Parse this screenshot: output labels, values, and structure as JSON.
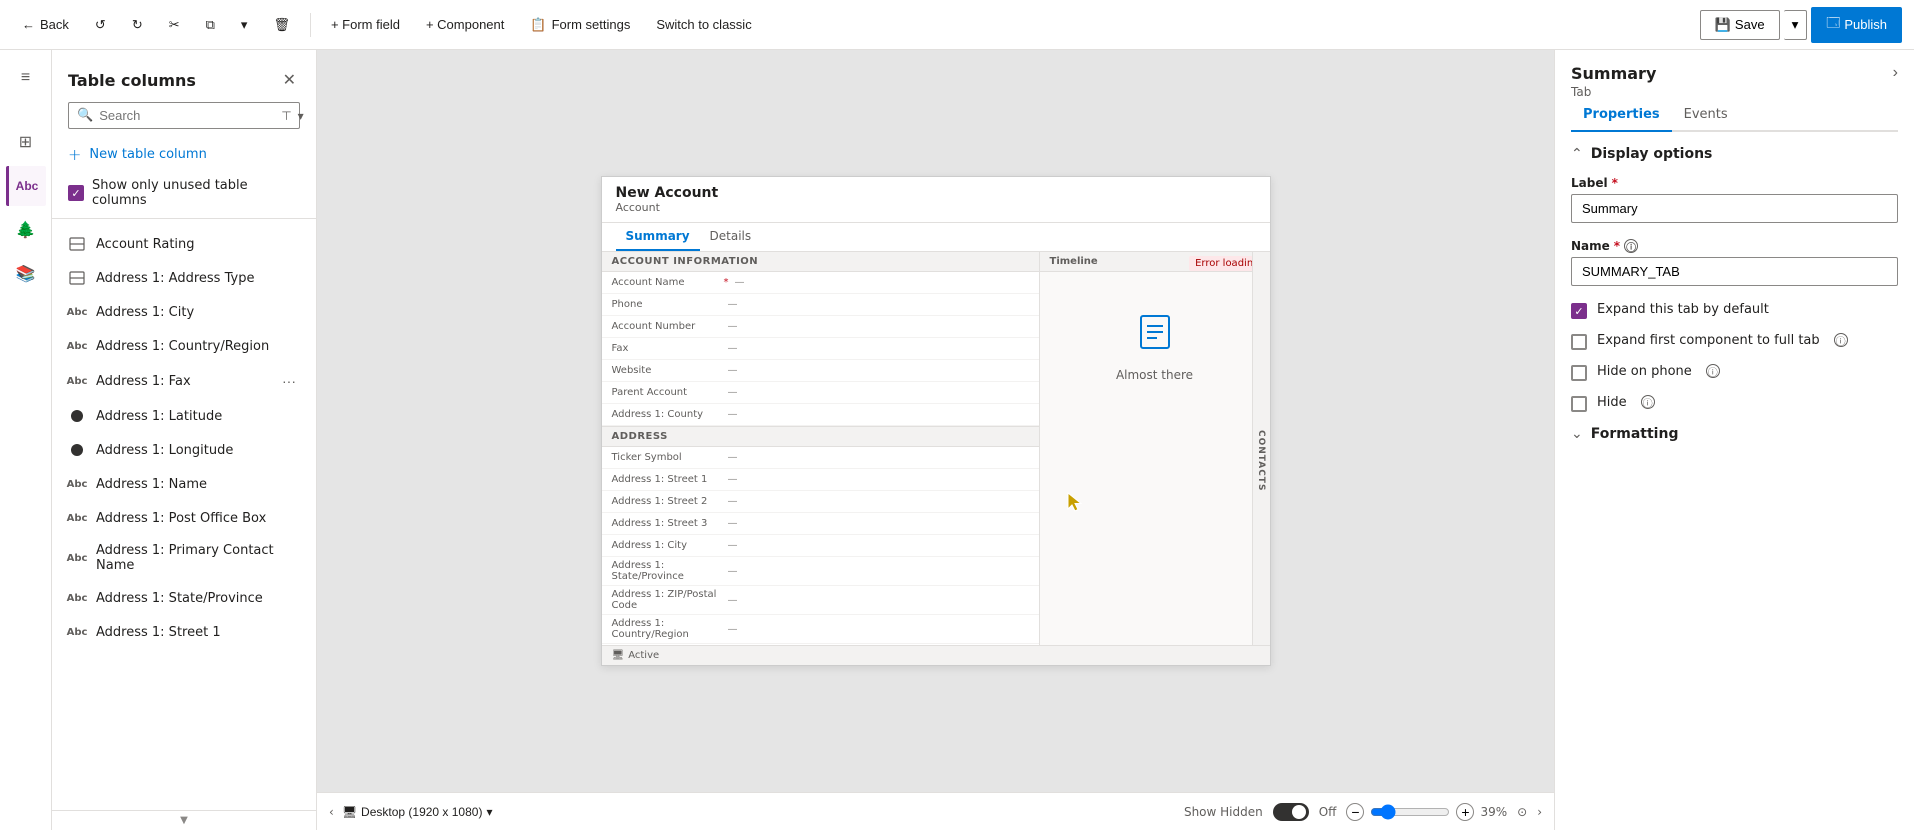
{
  "toolbar": {
    "back_label": "Back",
    "form_field_label": "+ Form field",
    "component_label": "+ Component",
    "form_settings_label": "Form settings",
    "switch_classic_label": "Switch to classic",
    "save_label": "Save",
    "publish_label": "Publish"
  },
  "sidebar": {
    "items": [
      {
        "id": "menu",
        "icon": "≡",
        "label": ""
      },
      {
        "id": "components",
        "icon": "⊞",
        "label": "Components"
      },
      {
        "id": "table-columns",
        "icon": "Abc",
        "label": "Table columns"
      },
      {
        "id": "tree-view",
        "icon": "🌲",
        "label": "Tree view"
      },
      {
        "id": "form-libraries",
        "icon": "📚",
        "label": "Form libraries"
      }
    ]
  },
  "panel": {
    "title": "Table columns",
    "search_placeholder": "Search",
    "new_column_label": "New table column",
    "show_unused_label": "Show only unused table columns",
    "columns": [
      {
        "id": "account-rating",
        "name": "Account Rating",
        "type": "select"
      },
      {
        "id": "address1-type",
        "name": "Address 1: Address Type",
        "type": "select"
      },
      {
        "id": "address1-city",
        "name": "Address 1: City",
        "type": "text"
      },
      {
        "id": "address1-country",
        "name": "Address 1: Country/Region",
        "type": "text"
      },
      {
        "id": "address1-fax",
        "name": "Address 1: Fax",
        "type": "text",
        "has_more": true
      },
      {
        "id": "address1-lat",
        "name": "Address 1: Latitude",
        "type": "number"
      },
      {
        "id": "address1-lng",
        "name": "Address 1: Longitude",
        "type": "number"
      },
      {
        "id": "address1-name",
        "name": "Address 1: Name",
        "type": "text"
      },
      {
        "id": "address1-po",
        "name": "Address 1: Post Office Box",
        "type": "text"
      },
      {
        "id": "address1-primary",
        "name": "Address 1: Primary Contact Name",
        "type": "text"
      },
      {
        "id": "address1-state",
        "name": "Address 1: State/Province",
        "type": "text"
      },
      {
        "id": "address1-street1",
        "name": "Address 1: Street 1",
        "type": "text"
      }
    ]
  },
  "form_preview": {
    "title": "New Account",
    "subtitle": "Account",
    "tabs": [
      {
        "id": "summary",
        "label": "Summary",
        "active": true
      },
      {
        "id": "details",
        "label": "Details",
        "active": false
      }
    ],
    "account_info_section": "ACCOUNT INFORMATION",
    "timeline_section": "Timeline",
    "fields": [
      {
        "label": "Account Name",
        "required": true,
        "value": "—"
      },
      {
        "label": "Phone",
        "value": "—"
      },
      {
        "label": "Account Number",
        "value": "—"
      },
      {
        "label": "Fax",
        "value": "—"
      },
      {
        "label": "Website",
        "value": "—"
      },
      {
        "label": "Parent Account",
        "value": "—"
      },
      {
        "label": "Address 1: County",
        "value": "—"
      }
    ],
    "address_section": "ADDRESS",
    "address_fields": [
      {
        "label": "Ticker Symbol",
        "value": "—"
      },
      {
        "label": "Address 1: Street 1",
        "value": "—"
      },
      {
        "label": "Address 1: Street 2",
        "value": "—"
      },
      {
        "label": "Address 1: Street 3",
        "value": "—"
      },
      {
        "label": "Address 1: City",
        "value": "—"
      },
      {
        "label": "Address 1: State/Province",
        "value": "—"
      },
      {
        "label": "Address 1: ZIP/Postal Code",
        "value": "—"
      },
      {
        "label": "Address 1: Country/Region",
        "value": "—"
      }
    ],
    "almost_there_text": "Almost there",
    "error_loading": "Error loading",
    "contacts_label": "CONTACTS",
    "active_label": "Active",
    "status_label": "Active"
  },
  "right_panel": {
    "title": "Summary",
    "subtitle": "Tab",
    "chevron": "›",
    "tabs": [
      {
        "id": "properties",
        "label": "Properties",
        "active": true
      },
      {
        "id": "events",
        "label": "Events",
        "active": false
      }
    ],
    "display_options_title": "Display options",
    "label_field": {
      "label": "Label",
      "required": true,
      "value": "Summary"
    },
    "name_field": {
      "label": "Name",
      "required": true,
      "value": "SUMMARY_TAB"
    },
    "checkboxes": [
      {
        "id": "expand-default",
        "label": "Expand this tab by default",
        "checked": true,
        "has_info": false
      },
      {
        "id": "expand-full",
        "label": "Expand first component to full tab",
        "checked": false,
        "has_info": true
      },
      {
        "id": "hide-phone",
        "label": "Hide on phone",
        "checked": false,
        "has_info": true
      },
      {
        "id": "hide",
        "label": "Hide",
        "checked": false,
        "has_info": true
      }
    ],
    "formatting_title": "Formatting"
  },
  "bottom_bar": {
    "desktop_label": "Desktop (1920 x 1080)",
    "show_hidden_label": "Show Hidden",
    "toggle_state": "Off",
    "zoom_label": "39%"
  }
}
